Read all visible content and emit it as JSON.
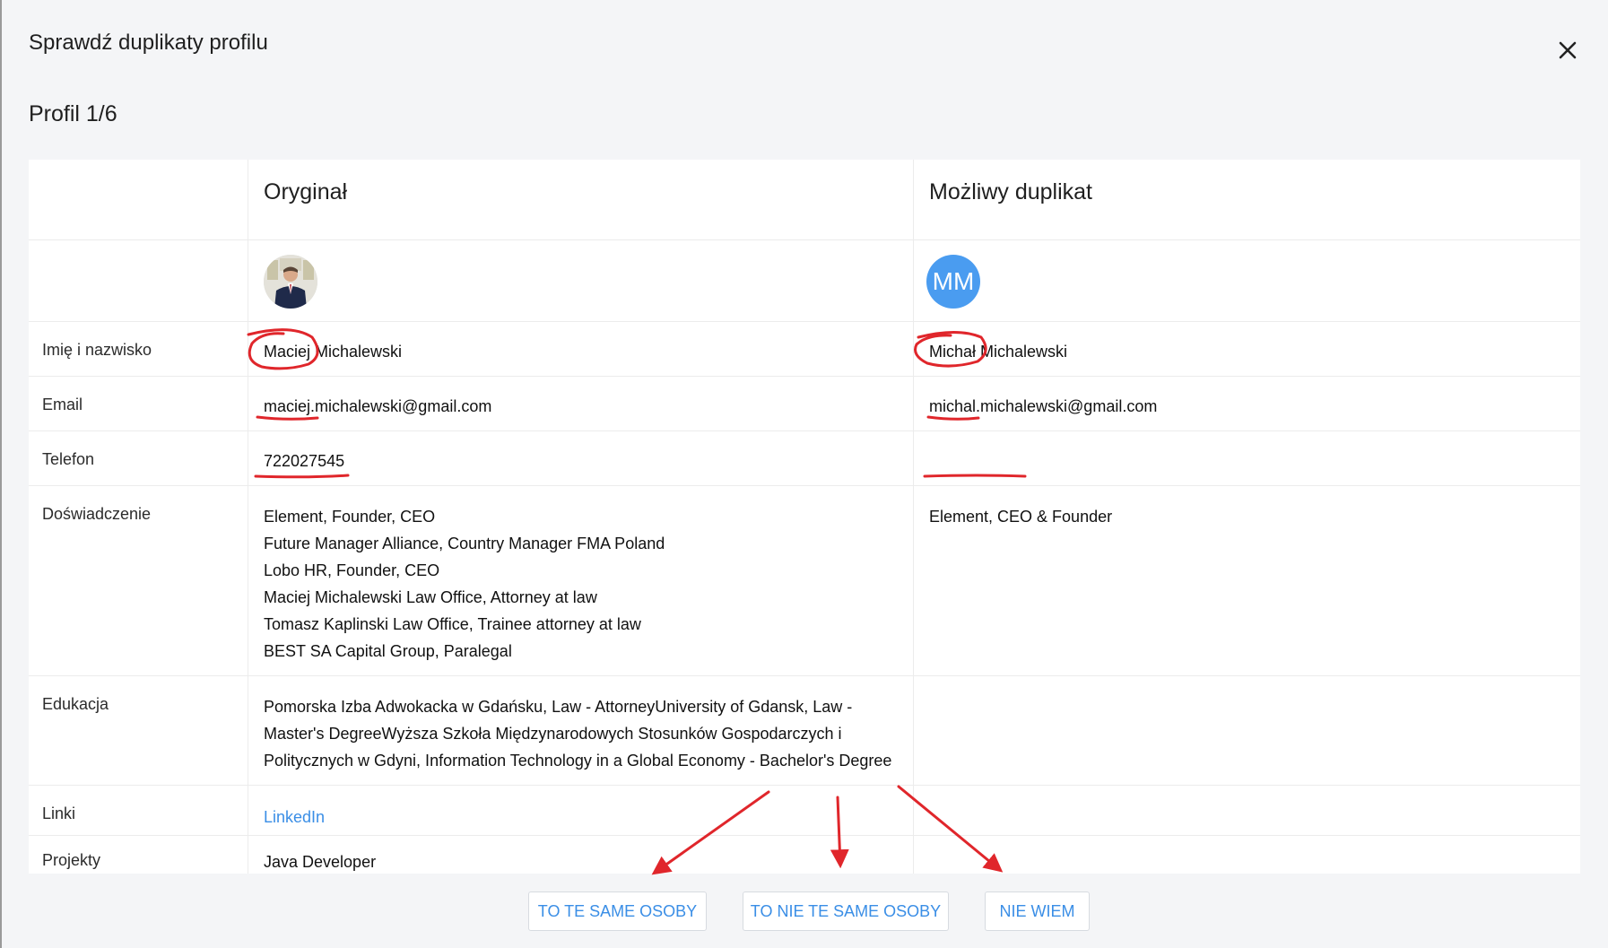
{
  "dialog": {
    "title": "Sprawdź duplikaty profilu",
    "profile_counter": "Profil 1/6"
  },
  "columns": {
    "original": "Oryginał",
    "duplicate": "Możliwy duplikat"
  },
  "avatars": {
    "duplicate_initials": "MM"
  },
  "rows": {
    "name": {
      "label": "Imię i nazwisko",
      "original": "Maciej Michalewski",
      "duplicate": "Michał Michalewski"
    },
    "email": {
      "label": "Email",
      "original": "maciej.michalewski@gmail.com",
      "duplicate": "michal.michalewski@gmail.com"
    },
    "phone": {
      "label": "Telefon",
      "original": "722027545",
      "duplicate": ""
    },
    "experience": {
      "label": "Doświadczenie",
      "original": [
        "Element, Founder, CEO",
        "Future Manager Alliance, Country Manager FMA Poland",
        "Lobo HR, Founder, CEO",
        "Maciej Michalewski Law Office, Attorney at law",
        "Tomasz Kaplinski Law Office, Trainee attorney at law",
        "BEST SA Capital Group, Paralegal"
      ],
      "duplicate": [
        "Element, CEO & Founder"
      ]
    },
    "education": {
      "label": "Edukacja",
      "original": "Pomorska Izba Adwokacka w Gdańsku, Law - AttorneyUniversity of Gdansk, Law - Master's DegreeWyższa Szkoła Międzynarodowych Stosunków Gospodarczych i Politycznych w Gdyni, Information Technology in a Global Economy - Bachelor's Degree",
      "duplicate": ""
    },
    "links": {
      "label": "Linki",
      "original": "LinkedIn",
      "duplicate": ""
    },
    "projects": {
      "label": "Projekty",
      "original": "Java Developer",
      "duplicate": ""
    }
  },
  "actions": {
    "same": "TO TE SAME OSOBY",
    "not_same": "TO NIE TE SAME OSOBY",
    "unknown": "NIE WIEM"
  },
  "colors": {
    "accent": "#3a8ee6",
    "avatar_bg": "#4a9cf0",
    "annotation": "#e0262b"
  }
}
